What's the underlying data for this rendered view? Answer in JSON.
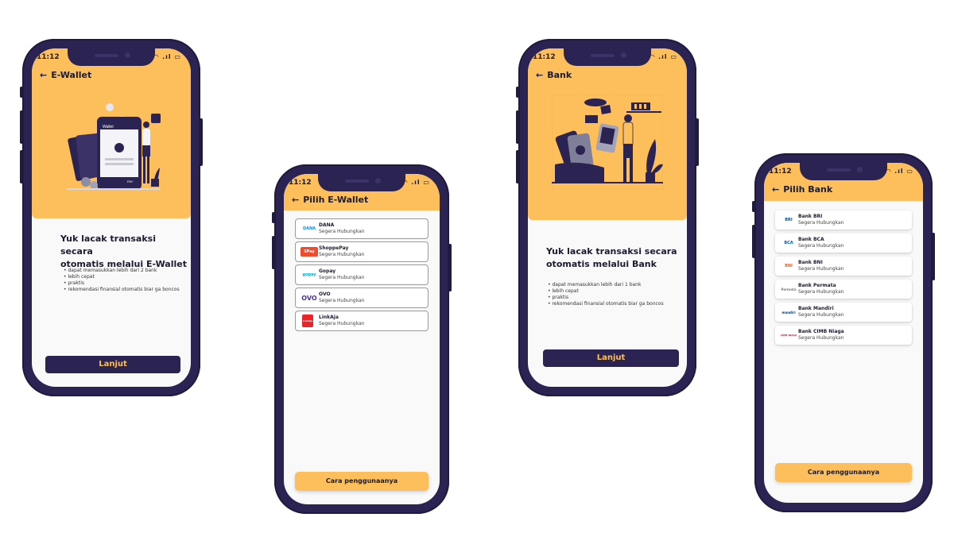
{
  "status": {
    "time": "11:12",
    "icons": "◠ .ıl ▭"
  },
  "ewallet": {
    "title": "E-Wallet",
    "headline_1": "Yuk lacak transaksi secara",
    "headline_2": "otomatis melalui E-Wallet",
    "bullets": [
      "dapat memasukkan lebih dari 2 bank",
      "lebih cepat",
      "praktis",
      "rekomendasi finansial otomatis biar ga boncos"
    ],
    "button": "Lanjut",
    "illustration_labels": {
      "wallet": "Wallet",
      "pay": "PAY"
    }
  },
  "pilih_ewallet": {
    "title": "Pilih E-Wallet",
    "items": [
      {
        "name": "DANA",
        "status": "Segera Hubungkan",
        "logo": "DANA"
      },
      {
        "name": "ShoppePay",
        "status": "Segera Hubungkan",
        "logo": "SPay"
      },
      {
        "name": "Gopay",
        "status": "Segera Hubungkan",
        "logo": "gopay"
      },
      {
        "name": "OVO",
        "status": "Segera Hubungkan",
        "logo": "OVO"
      },
      {
        "name": "LinkAja",
        "status": "Segera Hubungkan",
        "logo": "LinkAja"
      }
    ],
    "button": "Cara penggunaanya"
  },
  "bank": {
    "title": "Bank",
    "headline_1": "Yuk lacak transaksi secara",
    "headline_2": "otomatis melalui Bank",
    "bullets": [
      "dapat memasukkan lebih dari 1 bank",
      "lebih cepat",
      "praktis",
      "rekomendasi finansial otomatis biar ga boncos"
    ],
    "button": "Lanjut"
  },
  "pilih_bank": {
    "title": "Pilih Bank",
    "items": [
      {
        "name": "Bank BRI",
        "status": "Segera Hubungkan",
        "logo": "BRI"
      },
      {
        "name": "Bank BCA",
        "status": "Segera Hubungkan",
        "logo": "BCA"
      },
      {
        "name": "Bank BNI",
        "status": "Segera Hubungkan",
        "logo": "BNI"
      },
      {
        "name": "Bank Permata",
        "status": "Segera Hubungkan",
        "logo": "Permata"
      },
      {
        "name": "Bank Mandiri",
        "status": "Segera Hubungkan",
        "logo": "mandiri"
      },
      {
        "name": "Bank CIMB Niaga",
        "status": "Segera Hubungkan",
        "logo": "CIMB NIAGA"
      }
    ],
    "button": "Cara penggunaanya"
  },
  "colors": {
    "accent": "#fcbf5b",
    "dark": "#2b2352",
    "screen": "#f9f9fa"
  }
}
